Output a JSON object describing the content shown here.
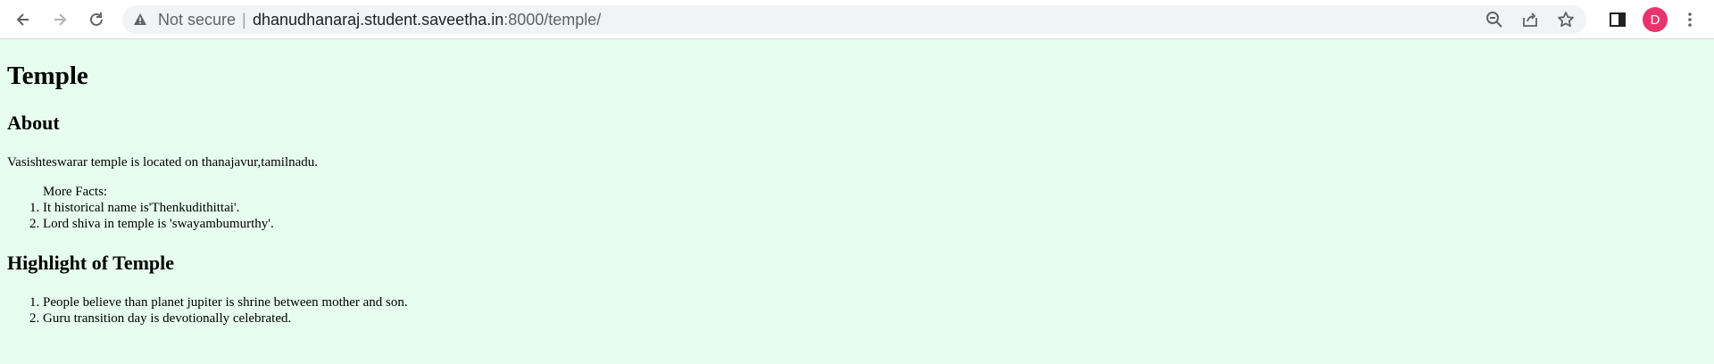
{
  "browser": {
    "security_label": "Not secure",
    "separator": "|",
    "url_host": "dhanudhanaraj.student.saveetha.in",
    "url_rest": ":8000/temple/",
    "avatar_letter": "D"
  },
  "page": {
    "title": "Temple",
    "about_heading": "About",
    "about_text": "Vasishteswarar temple is located on thanajavur,tamilnadu.",
    "facts_label": "More Facts:",
    "facts": [
      "It historical name is'Thenkudithittai'.",
      "Lord shiva in temple is 'swayambumurthy'."
    ],
    "highlight_heading": "Highlight of Temple",
    "highlights": [
      "People believe than planet jupiter is shrine between mother and son.",
      "Guru transition day is devotionally celebrated."
    ]
  }
}
